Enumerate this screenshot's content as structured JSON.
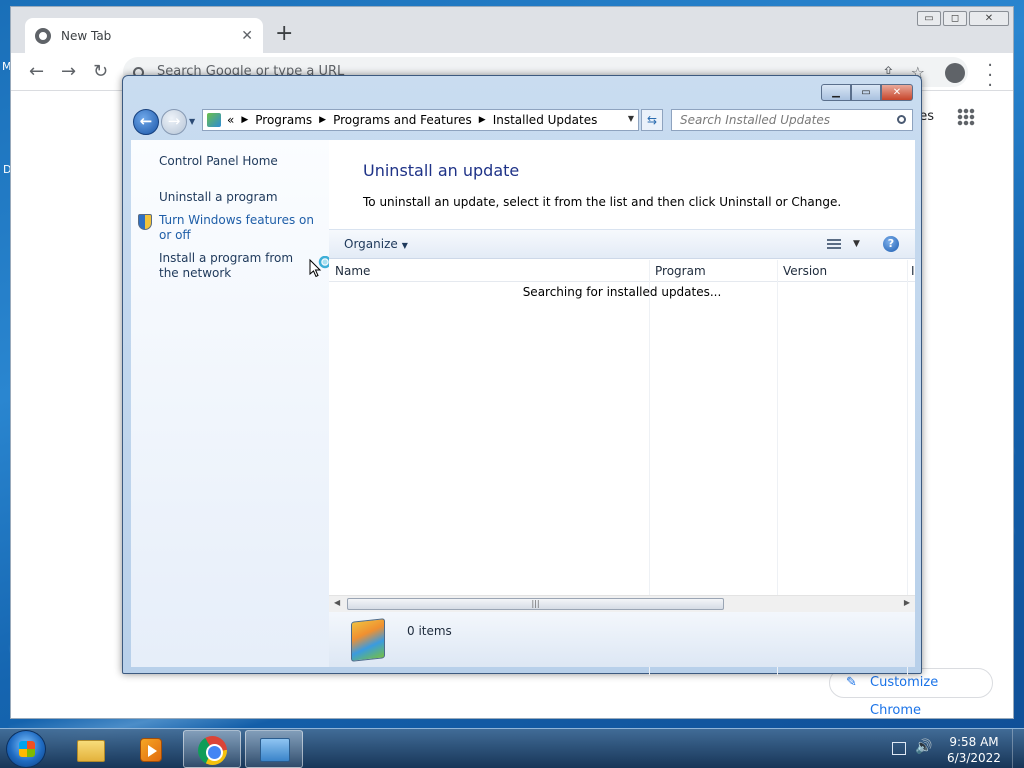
{
  "desktop": {
    "edge_labels": [
      "M",
      "D"
    ]
  },
  "chrome": {
    "tab_title": "New Tab",
    "tab_close": "✕",
    "new_tab": "+",
    "omnibox_placeholder": "Search Google or type a URL",
    "images_link": "ges",
    "customize_label": "Customize Chrome",
    "controls": {
      "minimize": "▭",
      "maximize": "◻",
      "close": "✕"
    }
  },
  "explorer": {
    "breadcrumb": [
      "Programs",
      "Programs and Features",
      "Installed Updates"
    ],
    "breadcrumb_prefix": "«",
    "search_placeholder": "Search Installed Updates",
    "left_pane": {
      "home": "Control Panel Home",
      "uninstall_program": "Uninstall a program",
      "windows_features": "Turn Windows features on or off",
      "install_from_network": "Install a program from the network"
    },
    "main": {
      "title": "Uninstall an update",
      "description": "To uninstall an update, select it from the list and then click Uninstall or Change.",
      "organize": "Organize",
      "columns": [
        "Name",
        "Program",
        "Version",
        "I"
      ],
      "searching": "Searching for installed updates...",
      "item_count": "0 items"
    }
  },
  "taskbar": {
    "time": "9:58 AM",
    "date": "6/3/2022"
  },
  "colors": {
    "explorer_title": "#1e3287",
    "link_blue": "#1f5ea8",
    "chrome_accent": "#1a73e8"
  }
}
